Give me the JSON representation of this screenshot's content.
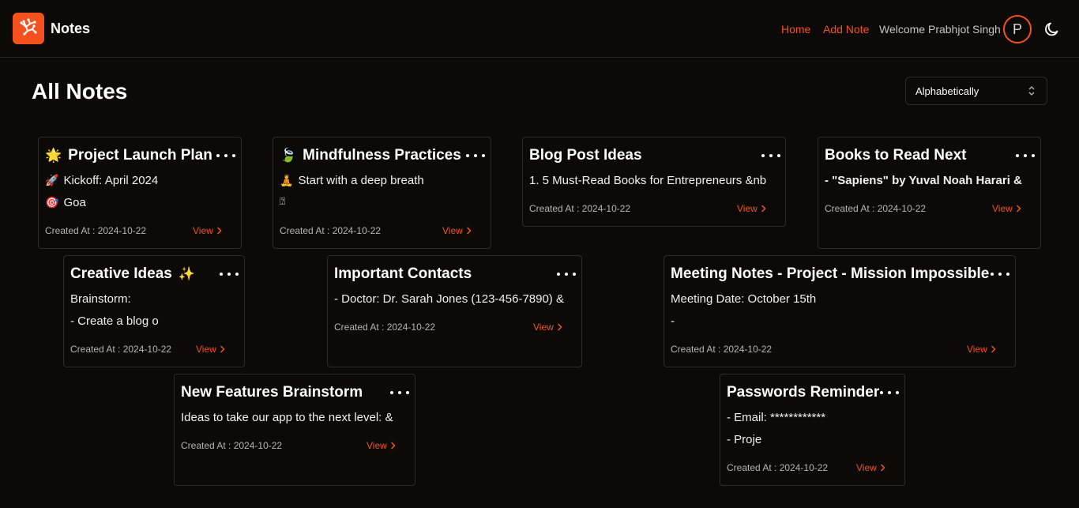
{
  "nav": {
    "brand": "Notes",
    "home": "Home",
    "add_note": "Add Note",
    "welcome": "Welcome Prabhjot Singh",
    "avatar_initial": "P"
  },
  "page": {
    "title": "All Notes",
    "sort_value": "Alphabetically"
  },
  "colors": {
    "accent": "#f4511e",
    "background": "#0b0a09",
    "card_border": "#2e2c2a"
  },
  "notes": [
    {
      "title": "Project Launch Plan",
      "emoji": "🌟",
      "lines": [
        {
          "icon": "🚀",
          "text": "Kickoff: April 2024"
        },
        {
          "icon": "🎯",
          "text": "Goa"
        }
      ],
      "created": "Created At : 2024-10-22",
      "view": "View"
    },
    {
      "title": "Mindfulness Practices",
      "emoji": "🍃",
      "lines": [
        {
          "icon": "🧘",
          "text": "Start with a deep breath"
        },
        {
          "icon": "",
          "text": "⍰"
        }
      ],
      "created": "Created At : 2024-10-22",
      "view": "View"
    },
    {
      "title": "Blog Post Ideas",
      "emoji": "",
      "lines": [
        {
          "icon": "",
          "text": "1. 5 Must-Read Books for Entrepreneurs &nb"
        }
      ],
      "created": "Created At : 2024-10-22",
      "view": "View"
    },
    {
      "title": "Books to Read Next",
      "emoji": "",
      "lines": [
        {
          "icon": "",
          "text": "- \"Sapiens\" by Yuval Noah Harari &"
        }
      ],
      "created": "Created At : 2024-10-22",
      "view": "View"
    },
    {
      "title": "Creative Ideas",
      "emoji_after": "✨",
      "lines": [
        {
          "icon": "",
          "text": "Brainstorm:"
        },
        {
          "icon": "",
          "text": "- Create a blog o"
        }
      ],
      "created": "Created At : 2024-10-22",
      "view": "View"
    },
    {
      "title": "Important Contacts",
      "emoji": "",
      "lines": [
        {
          "icon": "",
          "text": "- Doctor: Dr. Sarah Jones (123-456-7890) &"
        }
      ],
      "created": "Created At : 2024-10-22",
      "view": "View"
    },
    {
      "title": "Meeting Notes - Project - Mission Impossible",
      "emoji": "",
      "lines": [
        {
          "icon": "",
          "text": "Meeting Date: October 15th"
        },
        {
          "icon": "",
          "text": "-"
        }
      ],
      "created": "Created At : 2024-10-22",
      "view": "View"
    },
    {
      "title": "New Features Brainstorm",
      "emoji": "",
      "lines": [
        {
          "icon": "",
          "text": "Ideas to take our app to the next level: &"
        }
      ],
      "created": "Created At : 2024-10-22",
      "view": "View"
    },
    {
      "title": "Passwords Reminder",
      "emoji": "",
      "lines": [
        {
          "icon": "",
          "text": "- Email: ************"
        },
        {
          "icon": "",
          "text": "- Proje"
        }
      ],
      "created": "Created At : 2024-10-22",
      "view": "View"
    }
  ]
}
